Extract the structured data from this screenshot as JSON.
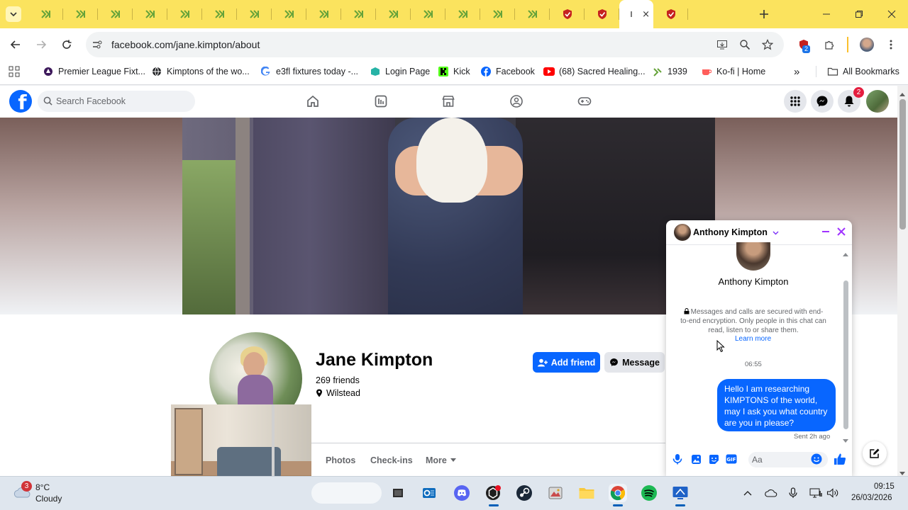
{
  "browser": {
    "tab_count_inactive": 18,
    "active_tab_close": "×",
    "url": "facebook.com/jane.kimpton/about",
    "extension_badge": "2"
  },
  "bookmarks": [
    {
      "label": "Premier League Fixt...",
      "icon": "premier-league-icon"
    },
    {
      "label": "Kimptons of the wo...",
      "icon": "globe-icon"
    },
    {
      "label": "e3fl fixtures today -...",
      "icon": "google-icon"
    },
    {
      "label": "Login Page",
      "icon": "login-icon"
    },
    {
      "label": "Kick",
      "icon": "kick-icon"
    },
    {
      "label": "Facebook",
      "icon": "facebook-icon"
    },
    {
      "label": "(68) Sacred Healing...",
      "icon": "youtube-icon"
    },
    {
      "label": "1939",
      "icon": "ancestry-icon"
    },
    {
      "label": "Ko-fi | Home",
      "icon": "kofi-icon"
    }
  ],
  "bookmarks_overflow": "»",
  "all_bookmarks": "All Bookmarks",
  "facebook": {
    "search_placeholder": "Search Facebook",
    "notifications_count": "2"
  },
  "profile": {
    "name": "Jane Kimpton",
    "friends": "269 friends",
    "location": "Wilstead",
    "add_friend": "Add friend",
    "message": "Message",
    "tabs": [
      "Photos",
      "Check-ins",
      "More"
    ]
  },
  "chat": {
    "contact_name": "Anthony Kimpton",
    "profile_name": "Anthony Kimpton",
    "encryption_notice": "Messages and calls are secured with end-to-end encryption. Only people in this chat can read, listen to or share them.",
    "learn_more": "Learn more",
    "timestamp": "06:55",
    "message": "Hello I am researching KIMPTONS of the world, may I ask you what country are you in please?",
    "sent_status": "Sent 2h ago",
    "input_placeholder": "Aa"
  },
  "taskbar": {
    "weather_badge": "3",
    "temperature": "8°C",
    "condition": "Cloudy",
    "time": "09:15",
    "date": "26/03/2026"
  },
  "colors": {
    "tab_strip": "#fbe35e",
    "facebook_blue": "#0866ff",
    "notification_red": "#e41e3f"
  }
}
